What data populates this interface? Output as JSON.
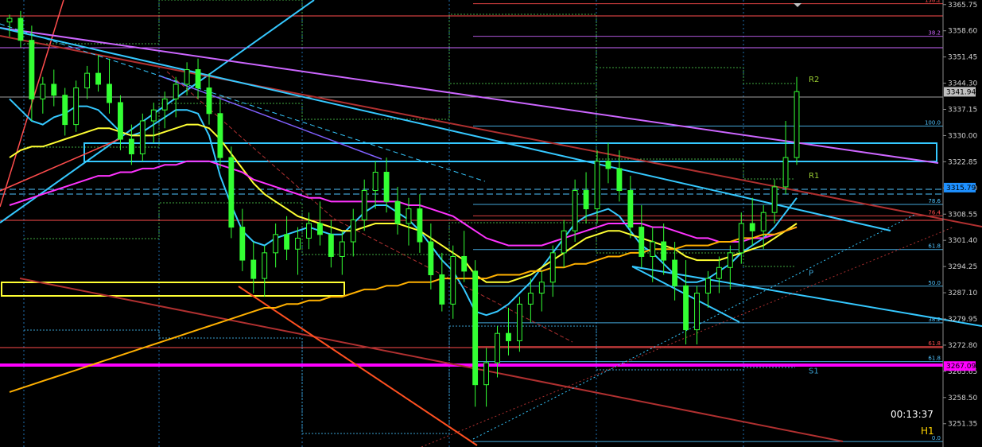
{
  "chart_data": {
    "type": "candlestick",
    "symbol_timeframe": "H1",
    "timer": "00:13:37",
    "y_axis": {
      "min": 3245.0,
      "max": 3367.0,
      "ticks": [
        "3365.75",
        "3358.60",
        "3351.45",
        "3344.30",
        "3337.15",
        "3330.00",
        "3322.85",
        "3315.70",
        "3308.55",
        "3301.40",
        "3294.25",
        "3287.10",
        "3279.95",
        "3272.80",
        "3265.65",
        "3258.50",
        "3251.35"
      ]
    },
    "price_tags": [
      {
        "value": 3341.94,
        "label": "3341.94",
        "bg": "#c0c0c0",
        "fg": "#000000"
      },
      {
        "value": 3315.79,
        "label": "3315.79",
        "bg": "#1e90ff",
        "fg": "#000000"
      },
      {
        "value": 3267.09,
        "label": "3267.09",
        "bg": "#ff00ff",
        "fg": "#000000"
      }
    ],
    "pivots": [
      {
        "name": "R2",
        "value": 3345.5
      },
      {
        "name": "R1",
        "value": 3319.2
      },
      {
        "name": "P",
        "value": 3292.6
      },
      {
        "name": "S1",
        "value": 3266.0
      }
    ],
    "fib_levels": [
      {
        "label": "138.2",
        "value": 3366.0,
        "color": "#ff4d4d"
      },
      {
        "label": "38.2",
        "value": 3357.1,
        "color": "#cc66ff"
      },
      {
        "label": "100.0",
        "value": 3332.6,
        "color": "#4fc3ff"
      },
      {
        "label": "78.6",
        "value": 3311.2,
        "color": "#4fc3ff"
      },
      {
        "label": "76.4",
        "value": 3308.1,
        "color": "#ff4d4d"
      },
      {
        "label": "61.8",
        "value": 3298.9,
        "color": "#4fc3ff"
      },
      {
        "label": "50.0",
        "value": 3288.9,
        "color": "#4fc3ff"
      },
      {
        "label": "38.2",
        "value": 3278.9,
        "color": "#4fc3ff"
      },
      {
        "label": "61.8",
        "value": 3272.4,
        "color": "#ff4d4d"
      },
      {
        "label": "61.8",
        "value": 3268.3,
        "color": "#4fc3ff"
      },
      {
        "label": "0.0",
        "value": 3246.5,
        "color": "#4fc3ff"
      }
    ],
    "candles": [
      [
        3361,
        3363,
        3357,
        3362
      ],
      [
        3362,
        3364,
        3354,
        3356
      ],
      [
        3356,
        3360,
        3334,
        3340
      ],
      [
        3340,
        3346,
        3336,
        3344
      ],
      [
        3344,
        3348,
        3338,
        3341
      ],
      [
        3341,
        3343,
        3330,
        3333
      ],
      [
        3333,
        3345,
        3331,
        3343
      ],
      [
        3343,
        3349,
        3340,
        3347
      ],
      [
        3347,
        3352,
        3342,
        3344
      ],
      [
        3344,
        3351,
        3336,
        3339
      ],
      [
        3339,
        3341,
        3326,
        3329
      ],
      [
        3329,
        3333,
        3322,
        3325
      ],
      [
        3325,
        3336,
        3323,
        3334
      ],
      [
        3334,
        3339,
        3328,
        3337
      ],
      [
        3337,
        3342,
        3332,
        3340
      ],
      [
        3340,
        3346,
        3335,
        3344
      ],
      [
        3344,
        3350,
        3341,
        3348
      ],
      [
        3348,
        3351,
        3340,
        3343
      ],
      [
        3343,
        3347,
        3333,
        3336
      ],
      [
        3336,
        3340,
        3321,
        3324
      ],
      [
        3324,
        3327,
        3302,
        3305
      ],
      [
        3305,
        3310,
        3293,
        3296
      ],
      [
        3296,
        3301,
        3287,
        3291
      ],
      [
        3291,
        3300,
        3286,
        3298
      ],
      [
        3298,
        3306,
        3294,
        3303
      ],
      [
        3303,
        3308,
        3296,
        3299
      ],
      [
        3299,
        3305,
        3292,
        3302
      ],
      [
        3302,
        3309,
        3299,
        3306
      ],
      [
        3306,
        3312,
        3300,
        3303
      ],
      [
        3303,
        3307,
        3294,
        3297
      ],
      [
        3297,
        3304,
        3292,
        3301
      ],
      [
        3301,
        3310,
        3297,
        3307
      ],
      [
        3307,
        3318,
        3304,
        3315
      ],
      [
        3315,
        3323,
        3310,
        3320
      ],
      [
        3320,
        3324,
        3309,
        3312
      ],
      [
        3312,
        3316,
        3303,
        3306
      ],
      [
        3306,
        3313,
        3300,
        3310
      ],
      [
        3310,
        3314,
        3298,
        3301
      ],
      [
        3301,
        3306,
        3288,
        3292
      ],
      [
        3292,
        3298,
        3282,
        3284
      ],
      [
        3284,
        3300,
        3280,
        3297
      ],
      [
        3297,
        3304,
        3290,
        3293
      ],
      [
        3293,
        3296,
        3256,
        3262
      ],
      [
        3262,
        3272,
        3256,
        3268
      ],
      [
        3268,
        3278,
        3264,
        3276
      ],
      [
        3276,
        3283,
        3270,
        3274
      ],
      [
        3274,
        3286,
        3271,
        3284
      ],
      [
        3284,
        3291,
        3279,
        3287
      ],
      [
        3287,
        3293,
        3282,
        3290
      ],
      [
        3290,
        3300,
        3286,
        3298
      ],
      [
        3298,
        3307,
        3294,
        3304
      ],
      [
        3304,
        3318,
        3301,
        3315
      ],
      [
        3315,
        3320,
        3306,
        3310
      ],
      [
        3310,
        3326,
        3306,
        3323
      ],
      [
        3323,
        3328,
        3317,
        3321
      ],
      [
        3321,
        3326,
        3312,
        3315
      ],
      [
        3315,
        3319,
        3302,
        3305
      ],
      [
        3305,
        3311,
        3294,
        3297
      ],
      [
        3297,
        3305,
        3290,
        3301
      ],
      [
        3301,
        3306,
        3292,
        3296
      ],
      [
        3296,
        3301,
        3285,
        3289
      ],
      [
        3289,
        3296,
        3273,
        3277
      ],
      [
        3277,
        3289,
        3273,
        3287
      ],
      [
        3287,
        3293,
        3283,
        3291
      ],
      [
        3291,
        3297,
        3287,
        3294
      ],
      [
        3294,
        3300,
        3288,
        3298
      ],
      [
        3298,
        3309,
        3295,
        3306
      ],
      [
        3306,
        3313,
        3300,
        3304
      ],
      [
        3304,
        3311,
        3299,
        3309
      ],
      [
        3309,
        3318,
        3306,
        3316
      ],
      [
        3316,
        3334,
        3314,
        3324
      ],
      [
        3324,
        3346,
        3322,
        3342
      ]
    ],
    "ma_series": [
      {
        "name": "cyan",
        "color": "#35c8ff",
        "values": [
          3340,
          3337,
          3334,
          3333,
          3335,
          3336,
          3338,
          3338,
          3337,
          3334,
          3331,
          3330,
          3331,
          3333,
          3335,
          3337,
          3337,
          3336,
          3330,
          3319,
          3311,
          3304,
          3301,
          3300,
          3302,
          3303,
          3304,
          3305,
          3304,
          3303,
          3303,
          3306,
          3309,
          3311,
          3311,
          3309,
          3307,
          3304,
          3300,
          3296,
          3293,
          3288,
          3282,
          3281,
          3282,
          3284,
          3287,
          3290,
          3294,
          3298,
          3302,
          3306,
          3308,
          3309,
          3310,
          3308,
          3304,
          3300,
          3298,
          3295,
          3292,
          3290,
          3290,
          3291,
          3293,
          3295,
          3298,
          3300,
          3302,
          3305,
          3309,
          3313
        ]
      },
      {
        "name": "yellow",
        "color": "#ffff33",
        "values": [
          3324,
          3326,
          3327,
          3327,
          3328,
          3329,
          3330,
          3331,
          3332,
          3332,
          3331,
          3330,
          3330,
          3330,
          3331,
          3332,
          3333,
          3333,
          3332,
          3329,
          3325,
          3321,
          3317,
          3314,
          3312,
          3310,
          3308,
          3307,
          3306,
          3305,
          3304,
          3304,
          3305,
          3306,
          3306,
          3306,
          3305,
          3304,
          3302,
          3300,
          3298,
          3296,
          3292,
          3290,
          3290,
          3290,
          3291,
          3292,
          3294,
          3296,
          3298,
          3300,
          3302,
          3303,
          3304,
          3304,
          3303,
          3302,
          3301,
          3300,
          3299,
          3297,
          3296,
          3296,
          3296,
          3297,
          3298,
          3299,
          3300,
          3302,
          3304,
          3306
        ]
      },
      {
        "name": "magenta",
        "color": "#ff33ff",
        "values": [
          3311,
          3312,
          3313,
          3314,
          3315,
          3316,
          3317,
          3318,
          3319,
          3319,
          3320,
          3320,
          3321,
          3321,
          3322,
          3322,
          3323,
          3323,
          3323,
          3322,
          3321,
          3320,
          3318,
          3317,
          3316,
          3315,
          3314,
          3313,
          3313,
          3312,
          3312,
          3312,
          3312,
          3312,
          3312,
          3312,
          3311,
          3311,
          3310,
          3309,
          3308,
          3306,
          3304,
          3302,
          3301,
          3300,
          3300,
          3300,
          3300,
          3301,
          3302,
          3303,
          3304,
          3305,
          3306,
          3306,
          3306,
          3306,
          3305,
          3305,
          3304,
          3303,
          3302,
          3302,
          3301,
          3301,
          3301,
          3302,
          3302,
          3303,
          3304,
          3305
        ]
      },
      {
        "name": "orange-long",
        "color": "#ffb000",
        "values": [
          3260,
          3261,
          3262,
          3263,
          3264,
          3265,
          3266,
          3267,
          3268,
          3269,
          3270,
          3271,
          3272,
          3273,
          3274,
          3275,
          3276,
          3277,
          3278,
          3279,
          3280,
          3281,
          3282,
          3283,
          3283,
          3284,
          3284,
          3285,
          3285,
          3286,
          3286,
          3287,
          3288,
          3288,
          3289,
          3289,
          3290,
          3290,
          3290,
          3291,
          3291,
          3291,
          3291,
          3291,
          3292,
          3292,
          3292,
          3293,
          3293,
          3294,
          3294,
          3295,
          3295,
          3296,
          3297,
          3297,
          3298,
          3298,
          3299,
          3299,
          3299,
          3300,
          3300,
          3300,
          3301,
          3301,
          3302,
          3302,
          3303,
          3303,
          3304,
          3305
        ]
      }
    ]
  }
}
